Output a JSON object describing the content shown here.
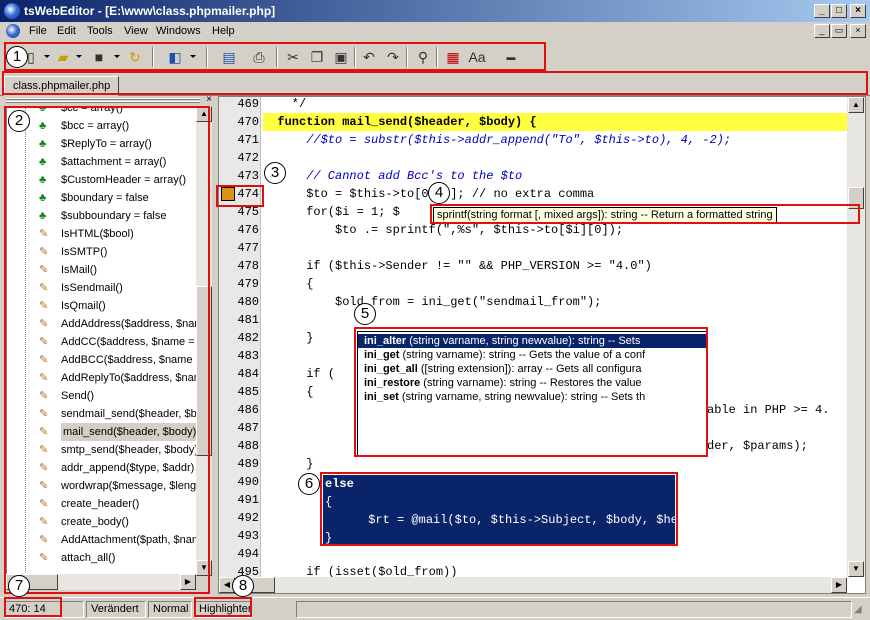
{
  "window": {
    "title": "tsWebEditor - [E:\\www\\class.phpmailer.php]"
  },
  "menu": [
    "File",
    "Edit",
    "Tools",
    "View",
    "Windows",
    "Help"
  ],
  "tab": {
    "label": "class.phpmailer.php"
  },
  "tree": [
    {
      "label": "$cc = array()",
      "kind": "var"
    },
    {
      "label": "$bcc = array()",
      "kind": "var"
    },
    {
      "label": "$ReplyTo = array()",
      "kind": "var"
    },
    {
      "label": "$attachment = array()",
      "kind": "var"
    },
    {
      "label": "$CustomHeader = array()",
      "kind": "var"
    },
    {
      "label": "$boundary = false",
      "kind": "var"
    },
    {
      "label": "$subboundary = false",
      "kind": "var"
    },
    {
      "label": "IsHTML($bool)",
      "kind": "fn"
    },
    {
      "label": "IsSMTP()",
      "kind": "fn"
    },
    {
      "label": "IsMail()",
      "kind": "fn"
    },
    {
      "label": "IsSendmail()",
      "kind": "fn"
    },
    {
      "label": "IsQmail()",
      "kind": "fn"
    },
    {
      "label": "AddAddress($address, $nam",
      "kind": "fn"
    },
    {
      "label": "AddCC($address, $name = ''",
      "kind": "fn"
    },
    {
      "label": "AddBCC($address, $name =",
      "kind": "fn"
    },
    {
      "label": "AddReplyTo($address, $nam",
      "kind": "fn"
    },
    {
      "label": "Send()",
      "kind": "fn"
    },
    {
      "label": "sendmail_send($header, $bc",
      "kind": "fn"
    },
    {
      "label": "mail_send($header, $body)",
      "kind": "fn",
      "selected": true
    },
    {
      "label": "smtp_send($header, $body)",
      "kind": "fn"
    },
    {
      "label": "addr_append($type, $addr)",
      "kind": "fn"
    },
    {
      "label": "wordwrap($message, $length",
      "kind": "fn"
    },
    {
      "label": "create_header()",
      "kind": "fn"
    },
    {
      "label": "create_body()",
      "kind": "fn"
    },
    {
      "label": "AddAttachment($path, $nam",
      "kind": "fn"
    },
    {
      "label": "attach_all()",
      "kind": "fn"
    }
  ],
  "code": [
    {
      "n": "469",
      "t": "    */"
    },
    {
      "n": "470",
      "t": "  function mail_send($header, $body) {",
      "hl": true
    },
    {
      "n": "471",
      "t": "      //$to = substr($this->addr_append(\"To\", $this->to), 4, -2);"
    },
    {
      "n": "472",
      "t": ""
    },
    {
      "n": "473",
      "t": "      // Cannot add Bcc's to the $to"
    },
    {
      "n": "474",
      "t": "      $to = $this->to[0][0]; // no extra comma"
    },
    {
      "n": "475",
      "t": "      for($i = 1; $"
    },
    {
      "n": "476",
      "t": "          $to .= sprintf(\",%s\", $this->to[$i][0]);"
    },
    {
      "n": "477",
      "t": ""
    },
    {
      "n": "478",
      "t": "      if ($this->Sender != \"\" && PHP_VERSION >= \"4.0\")"
    },
    {
      "n": "479",
      "t": "      {"
    },
    {
      "n": "480",
      "t": "          $old_from = ini_get(\"sendmail_from\");"
    },
    {
      "n": "481",
      "t": ""
    },
    {
      "n": "482",
      "t": "      }"
    },
    {
      "n": "483",
      "t": ""
    },
    {
      "n": "484",
      "t": "      if ("
    },
    {
      "n": "485",
      "t": "      {"
    },
    {
      "n": "486",
      "t": ""
    },
    {
      "n": "487",
      "t": ""
    },
    {
      "n": "488",
      "t": ""
    },
    {
      "n": "489",
      "t": "      }"
    },
    {
      "n": "490",
      "t": ""
    },
    {
      "n": "491",
      "t": ""
    },
    {
      "n": "492",
      "t": ""
    },
    {
      "n": "493",
      "t": ""
    },
    {
      "n": "494",
      "t": ""
    },
    {
      "n": "495",
      "t": "      if (isset($old_from))"
    }
  ],
  "code_fragments": {
    "f486": "able in PHP >= 4.",
    "f488": "der, $params);",
    "f484": "\")"
  },
  "tooltip": {
    "text": "sprintf(string format [, mixed args]): string -- Return a formatted string"
  },
  "autocomplete": [
    {
      "name": "ini_alter",
      "sig": " (string varname, string newvalue): string -- Sets"
    },
    {
      "name": "ini_get",
      "sig": " (string varname): string -- Gets the value of a conf"
    },
    {
      "name": "ini_get_all",
      "sig": " ([string extension]): array -- Gets all configura"
    },
    {
      "name": "ini_restore",
      "sig": " (string varname): string -- Restores the value"
    },
    {
      "name": "ini_set",
      "sig": " (string varname, string newvalue): string -- Sets th"
    }
  ],
  "elseblock": {
    "l1": "else",
    "l2": "{",
    "l3": "      $rt = @mail($to, $this->Subject, $body, $header);",
    "l4": "}"
  },
  "status": {
    "pos": "470: 14",
    "modified": "Verändert",
    "mode": "Normal",
    "highlighter": "Highlighter"
  },
  "callouts": [
    "1",
    "2",
    "3",
    "4",
    "5",
    "6",
    "7",
    "8"
  ]
}
